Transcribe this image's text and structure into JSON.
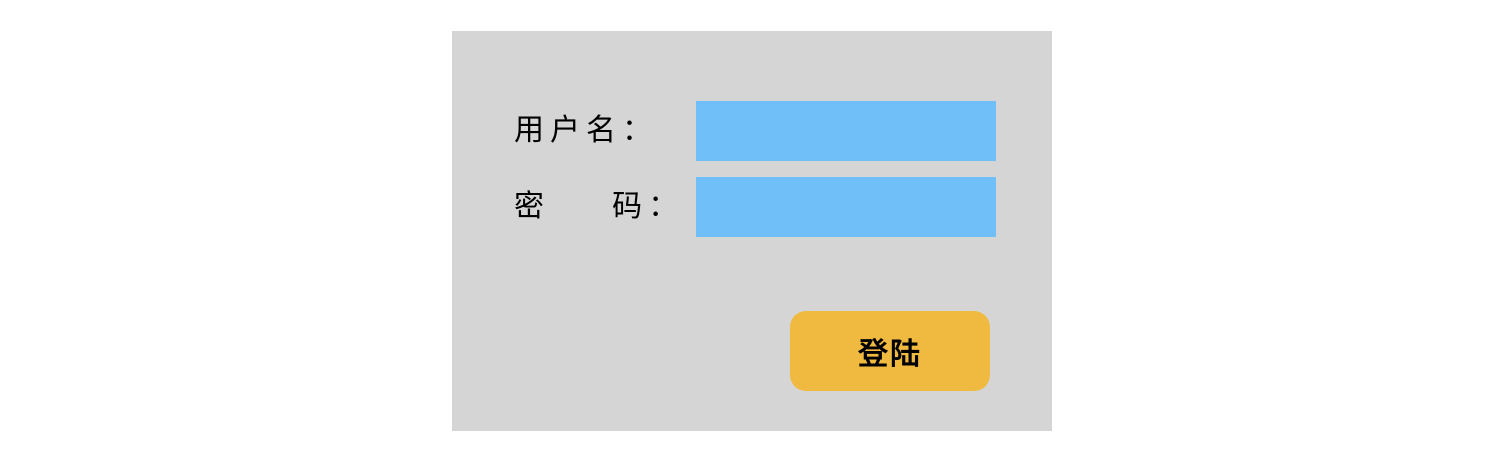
{
  "login_form": {
    "username_label": "用户名：",
    "password_label": "密    码：",
    "username_value": "",
    "password_value": "",
    "login_button_label": "登陆"
  },
  "colors": {
    "page_background": "#ffffff",
    "panel_background": "#d5d5d5",
    "input_background": "#70bff9",
    "button_background": "#f0ba41"
  }
}
